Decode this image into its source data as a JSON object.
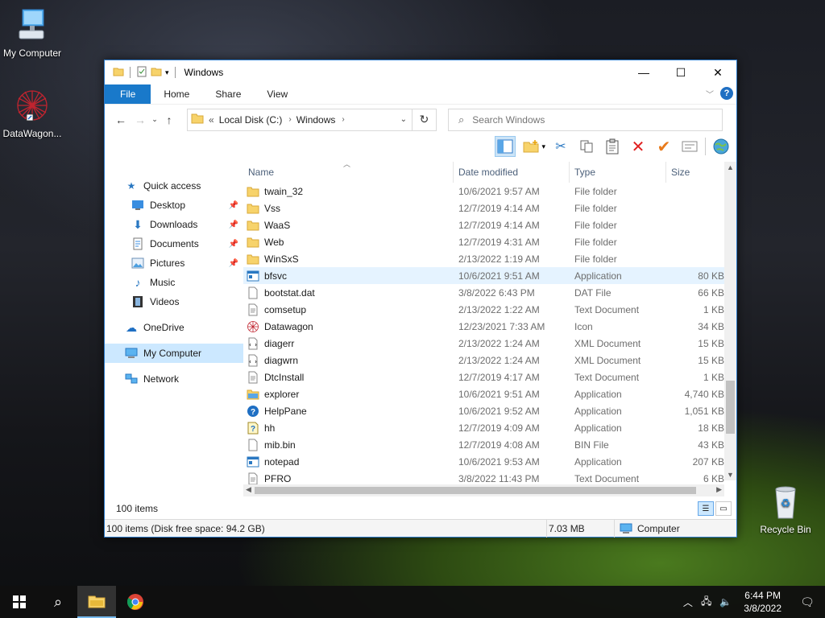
{
  "desktop": {
    "icons": [
      {
        "label": "My Computer",
        "icon": "computer-icon"
      },
      {
        "label": "DataWagon...",
        "icon": "datawagon-icon"
      },
      {
        "label": "Recycle Bin",
        "icon": "recycle-bin-icon"
      }
    ]
  },
  "window": {
    "title": "Windows",
    "controls": {
      "minimize": "—",
      "maximize": "☐",
      "close": "✕"
    }
  },
  "ribbon": {
    "tabs": [
      "File",
      "Home",
      "Share",
      "View"
    ],
    "help": "?"
  },
  "address": {
    "overflow": "«",
    "segments": [
      "Local Disk (C:)",
      "Windows"
    ],
    "search_placeholder": "Search Windows"
  },
  "nav_pane": {
    "quick_access": "Quick access",
    "quick_items": [
      "Desktop",
      "Downloads",
      "Documents",
      "Pictures",
      "Music",
      "Videos"
    ],
    "onedrive": "OneDrive",
    "my_computer": "My Computer",
    "network": "Network"
  },
  "columns": {
    "name": "Name",
    "date": "Date modified",
    "type": "Type",
    "size": "Size"
  },
  "files": [
    {
      "name": "twain_32",
      "date": "10/6/2021 9:57 AM",
      "type": "File folder",
      "size": "",
      "icon": "folder-icon"
    },
    {
      "name": "Vss",
      "date": "12/7/2019 4:14 AM",
      "type": "File folder",
      "size": "",
      "icon": "folder-icon"
    },
    {
      "name": "WaaS",
      "date": "12/7/2019 4:14 AM",
      "type": "File folder",
      "size": "",
      "icon": "folder-icon"
    },
    {
      "name": "Web",
      "date": "12/7/2019 4:31 AM",
      "type": "File folder",
      "size": "",
      "icon": "folder-icon"
    },
    {
      "name": "WinSxS",
      "date": "2/13/2022 1:19 AM",
      "type": "File folder",
      "size": "",
      "icon": "folder-icon"
    },
    {
      "name": "bfsvc",
      "date": "10/6/2021 9:51 AM",
      "type": "Application",
      "size": "80 KB",
      "icon": "app-icon",
      "highlight": true
    },
    {
      "name": "bootstat.dat",
      "date": "3/8/2022 6:43 PM",
      "type": "DAT File",
      "size": "66 KB",
      "icon": "file-icon"
    },
    {
      "name": "comsetup",
      "date": "2/13/2022 1:22 AM",
      "type": "Text Document",
      "size": "1 KB",
      "icon": "text-file-icon"
    },
    {
      "name": "Datawagon",
      "date": "12/23/2021 7:33 AM",
      "type": "Icon",
      "size": "34 KB",
      "icon": "datawagon-icon"
    },
    {
      "name": "diagerr",
      "date": "2/13/2022 1:24 AM",
      "type": "XML Document",
      "size": "15 KB",
      "icon": "xml-file-icon"
    },
    {
      "name": "diagwrn",
      "date": "2/13/2022 1:24 AM",
      "type": "XML Document",
      "size": "15 KB",
      "icon": "xml-file-icon"
    },
    {
      "name": "DtcInstall",
      "date": "12/7/2019 4:17 AM",
      "type": "Text Document",
      "size": "1 KB",
      "icon": "text-file-icon"
    },
    {
      "name": "explorer",
      "date": "10/6/2021 9:51 AM",
      "type": "Application",
      "size": "4,740 KB",
      "icon": "explorer-icon"
    },
    {
      "name": "HelpPane",
      "date": "10/6/2021 9:52 AM",
      "type": "Application",
      "size": "1,051 KB",
      "icon": "help-icon"
    },
    {
      "name": "hh",
      "date": "12/7/2019 4:09 AM",
      "type": "Application",
      "size": "18 KB",
      "icon": "hh-icon"
    },
    {
      "name": "mib.bin",
      "date": "12/7/2019 4:08 AM",
      "type": "BIN File",
      "size": "43 KB",
      "icon": "file-icon"
    },
    {
      "name": "notepad",
      "date": "10/6/2021 9:53 AM",
      "type": "Application",
      "size": "207 KB",
      "icon": "app-icon"
    },
    {
      "name": "PFRO",
      "date": "3/8/2022 11:43 PM",
      "type": "Text Document",
      "size": "6 KB",
      "icon": "text-file-icon"
    }
  ],
  "items_count": "100 items",
  "status": {
    "left": "100 items (Disk free space: 94.2 GB)",
    "size": "7.03 MB",
    "location": "Computer"
  },
  "taskbar": {
    "time": "6:44 PM",
    "date": "3/8/2022"
  },
  "colors": {
    "accent": "#1979ca",
    "selection": "#cce8ff",
    "hover_row": "#e5f3ff",
    "folder": "#f7d36b"
  }
}
